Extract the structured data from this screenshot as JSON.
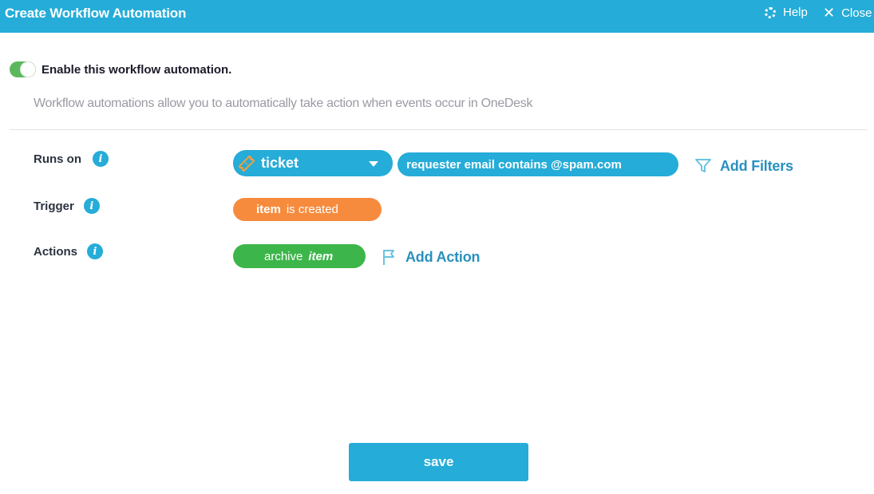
{
  "header": {
    "title": "Create Workflow Automation",
    "help_label": "Help",
    "close_label": "Close"
  },
  "enable": {
    "label": "Enable this workflow automation.",
    "checked": true,
    "color": "#5cb85c"
  },
  "description": "Workflow automations allow you to automatically take action when events occur in OneDesk",
  "rows": {
    "runs_on": {
      "label": "Runs on",
      "selected": "ticket",
      "filter": "requester email contains @spam.com",
      "add_filters_label": "Add Filters"
    },
    "trigger": {
      "label": "Trigger",
      "subject": "item",
      "event": "is created",
      "color": "#f78b3d"
    },
    "actions": {
      "label": "Actions",
      "verb": "archive",
      "object": "item",
      "add_action_label": "Add Action",
      "color": "#3cb64a"
    }
  },
  "footer": {
    "save_label": "save"
  },
  "colors": {
    "accent": "#25acd8",
    "link": "#2a90bf"
  }
}
